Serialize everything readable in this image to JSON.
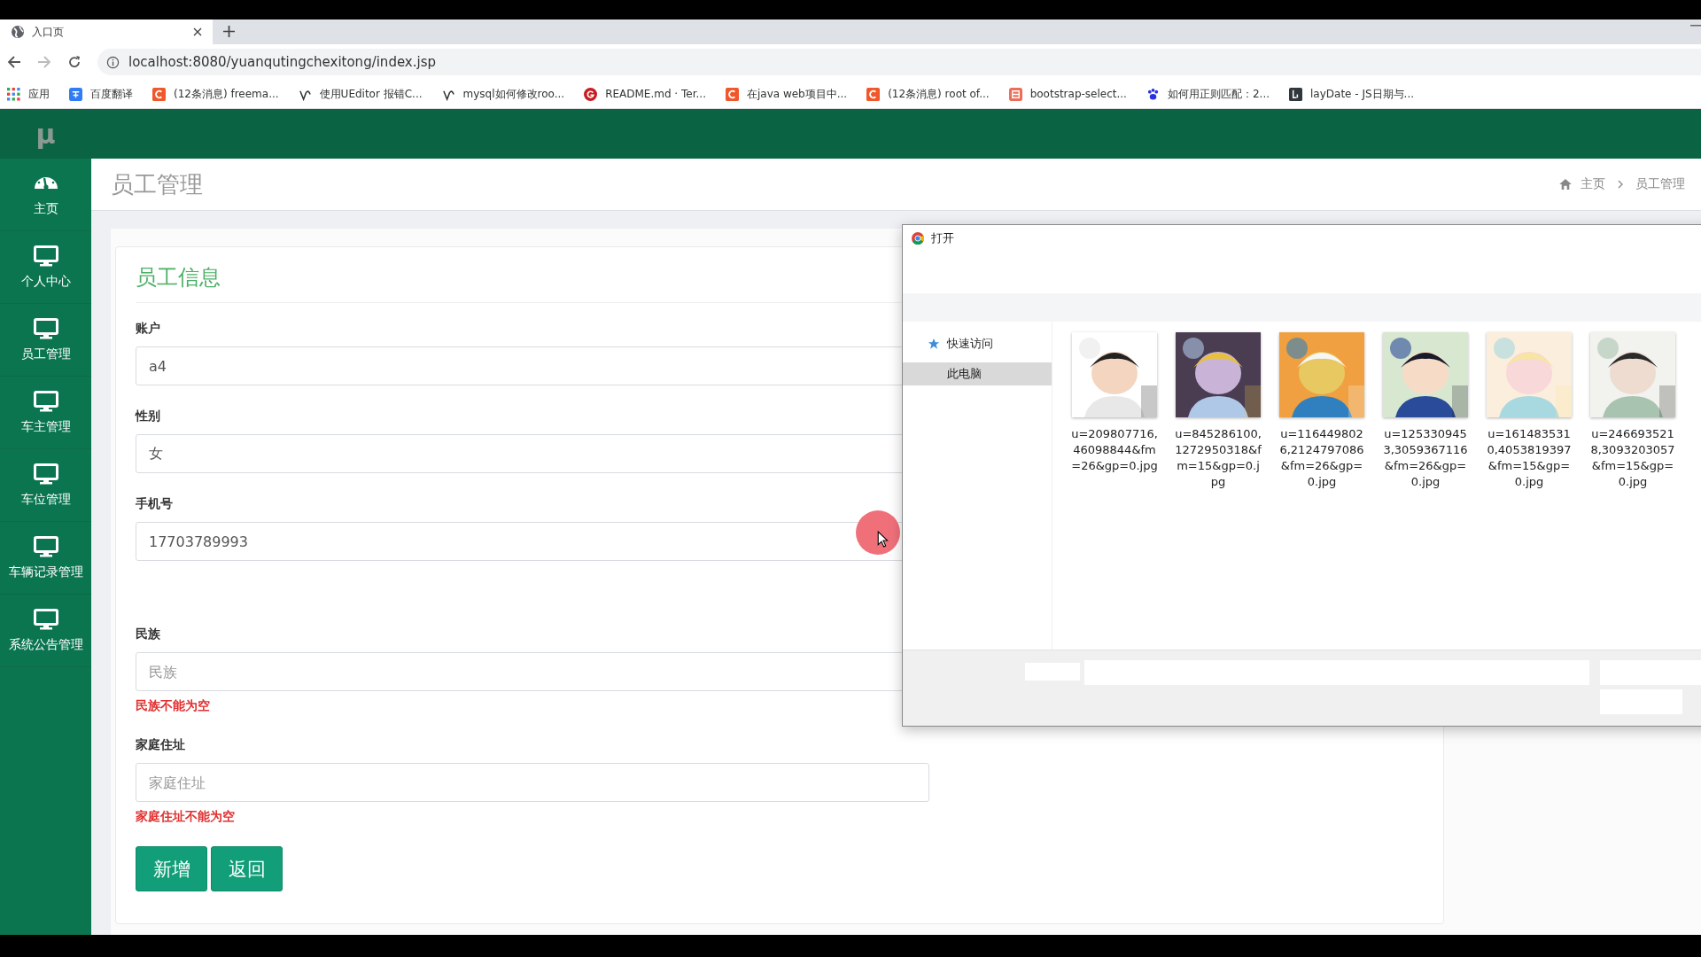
{
  "browser": {
    "tab": {
      "title": "入口页"
    },
    "address": "localhost:8080/yuanqutingchexitong/index.jsp",
    "bookmarks": [
      {
        "label": "应用",
        "kind": "apps"
      },
      {
        "label": "百度翻译",
        "kind": "translate"
      },
      {
        "label": "(12条消息) freema...",
        "kind": "c-mark"
      },
      {
        "label": "使用UEditor 报错C...",
        "kind": "swirl"
      },
      {
        "label": "mysql如何修改roo...",
        "kind": "swirl"
      },
      {
        "label": "README.md · Ter...",
        "kind": "g-mark"
      },
      {
        "label": "在java web项目中...",
        "kind": "c-mark"
      },
      {
        "label": "(12条消息) root of...",
        "kind": "c-mark"
      },
      {
        "label": "bootstrap-select...",
        "kind": "jian"
      },
      {
        "label": "如何用正则匹配：2...",
        "kind": "paw"
      },
      {
        "label": "layDate - JS日期与...",
        "kind": "lay"
      }
    ]
  },
  "app": {
    "logo": "μ",
    "sidebar": [
      {
        "label": "主页",
        "kind": "dashboard"
      },
      {
        "label": "个人中心",
        "kind": "monitor"
      },
      {
        "label": "员工管理",
        "kind": "monitor"
      },
      {
        "label": "车主管理",
        "kind": "monitor"
      },
      {
        "label": "车位管理",
        "kind": "monitor"
      },
      {
        "label": "车辆记录管理",
        "kind": "monitor"
      },
      {
        "label": "系统公告管理",
        "kind": "monitor"
      }
    ],
    "page_title": "员工管理",
    "breadcrumb": [
      "主页",
      "员工管理"
    ],
    "form": {
      "title": "员工信息",
      "fields": [
        {
          "label": "账户",
          "value": "a4"
        },
        {
          "label": "性别",
          "value": "女"
        },
        {
          "label": "手机号",
          "value": "17703789993"
        },
        {
          "label": "民族",
          "placeholder": "民族",
          "error": "民族不能为空"
        },
        {
          "label": "家庭住址",
          "placeholder": "家庭住址",
          "error": "家庭住址不能为空"
        }
      ],
      "buttons": [
        "新增",
        "返回"
      ]
    }
  },
  "dialog": {
    "title": "打开",
    "nav": [
      {
        "label": "快速访问",
        "kind": "star",
        "selected": false
      },
      {
        "label": "此电脑",
        "kind": "plain",
        "selected": true
      }
    ],
    "files": [
      {
        "name": "u=209807716,46098844&fm=26&gp=0.jpg"
      },
      {
        "name": "u=845286100,1272950318&fm=15&gp=0.jpg"
      },
      {
        "name": "u=1164498026,2124797086&fm=26&gp=0.jpg"
      },
      {
        "name": "u=1253309453,3059367116&fm=26&gp=0.jpg"
      },
      {
        "name": "u=1614835310,4053819397&fm=15&gp=0.jpg"
      },
      {
        "name": "u=2466935218,3093203057&fm=15&gp=0.jpg"
      }
    ]
  }
}
